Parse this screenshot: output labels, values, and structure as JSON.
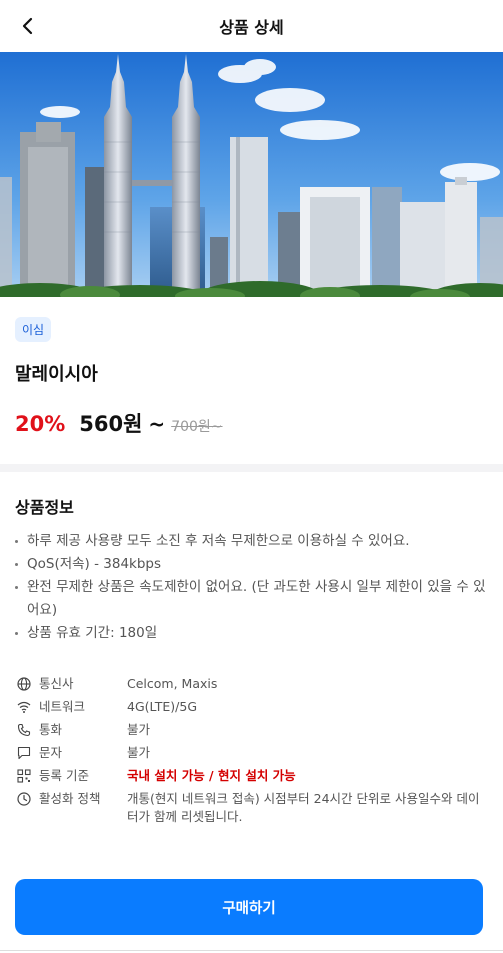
{
  "header": {
    "title": "상품 상세"
  },
  "product": {
    "badge": "이심",
    "name": "말레이시아",
    "discount": "20%",
    "price": "560원",
    "tilde": "~",
    "original_price": "700원~"
  },
  "info_section": {
    "title": "상품정보",
    "bullets": [
      "하루 제공 사용량 모두 소진 후 저속 무제한으로 이용하실 수 있어요.",
      "QoS(저속) - 384kbps",
      "완전 무제한 상품은 속도제한이 없어요. (단 과도한 사용시 일부 제한이 있을 수 있어요)",
      "상품 유효 기간: 180일"
    ]
  },
  "specs": [
    {
      "icon": "globe-icon",
      "label": "통신사",
      "value": "Celcom, Maxis"
    },
    {
      "icon": "wifi-icon",
      "label": "네트워크",
      "value": "4G(LTE)/5G"
    },
    {
      "icon": "phone-icon",
      "label": "통화",
      "value": "불가"
    },
    {
      "icon": "message-icon",
      "label": "문자",
      "value": "불가"
    },
    {
      "icon": "qr-icon",
      "label": "등록 기준",
      "value": "국내 설치 가능 / 현지 설치 가능"
    },
    {
      "icon": "clock-icon",
      "label": "활성화 정책",
      "value": "개통(현지 네트워크 접속) 시점부터 24시간 단위로 사용일수와 데이터가 함께 리셋됩니다."
    }
  ],
  "colors": {
    "accent": "#0a7cff",
    "discount": "#e0111a",
    "register_highlight": "#d40000"
  },
  "buy_button": {
    "label": "구매하기"
  }
}
